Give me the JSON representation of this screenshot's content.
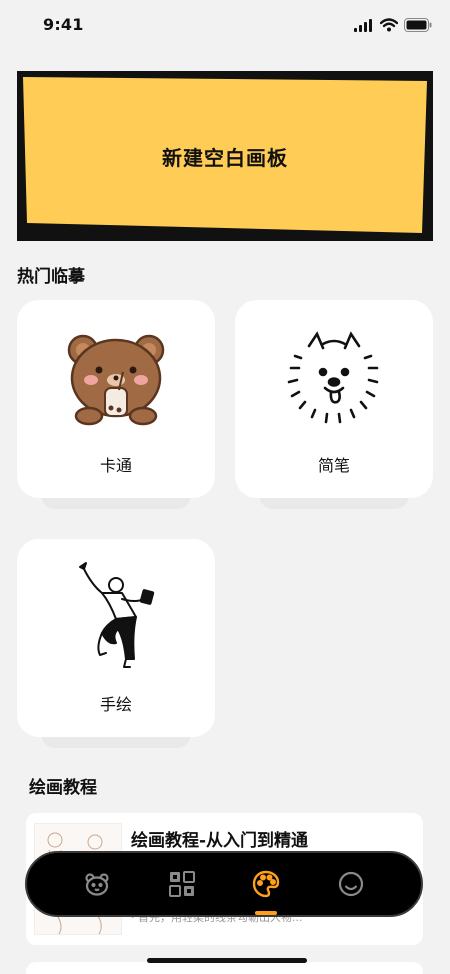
{
  "status_bar": {
    "time": "9:41"
  },
  "hero": {
    "title": "新建空白画板",
    "color": "#ffcd55"
  },
  "popular": {
    "title": "热门临摹",
    "cards": [
      {
        "label": "卡通",
        "icon": "bear-icon"
      },
      {
        "label": "简笔",
        "icon": "dog-sketch-icon"
      },
      {
        "label": "手绘",
        "icon": "dancer-sketch-icon"
      }
    ]
  },
  "tutorials": {
    "title": "绘画教程",
    "items": [
      {
        "title": "绘画教程-从入门到精通",
        "desc": "· 首先，用轻柔的线条勾勒出人物..."
      }
    ]
  },
  "tabbar": {
    "tabs": [
      {
        "name": "bear-tab-icon"
      },
      {
        "name": "grid-tab-icon"
      },
      {
        "name": "palette-tab-icon",
        "active": true,
        "color": "#ff9f1c"
      },
      {
        "name": "smiley-tab-icon"
      }
    ]
  }
}
